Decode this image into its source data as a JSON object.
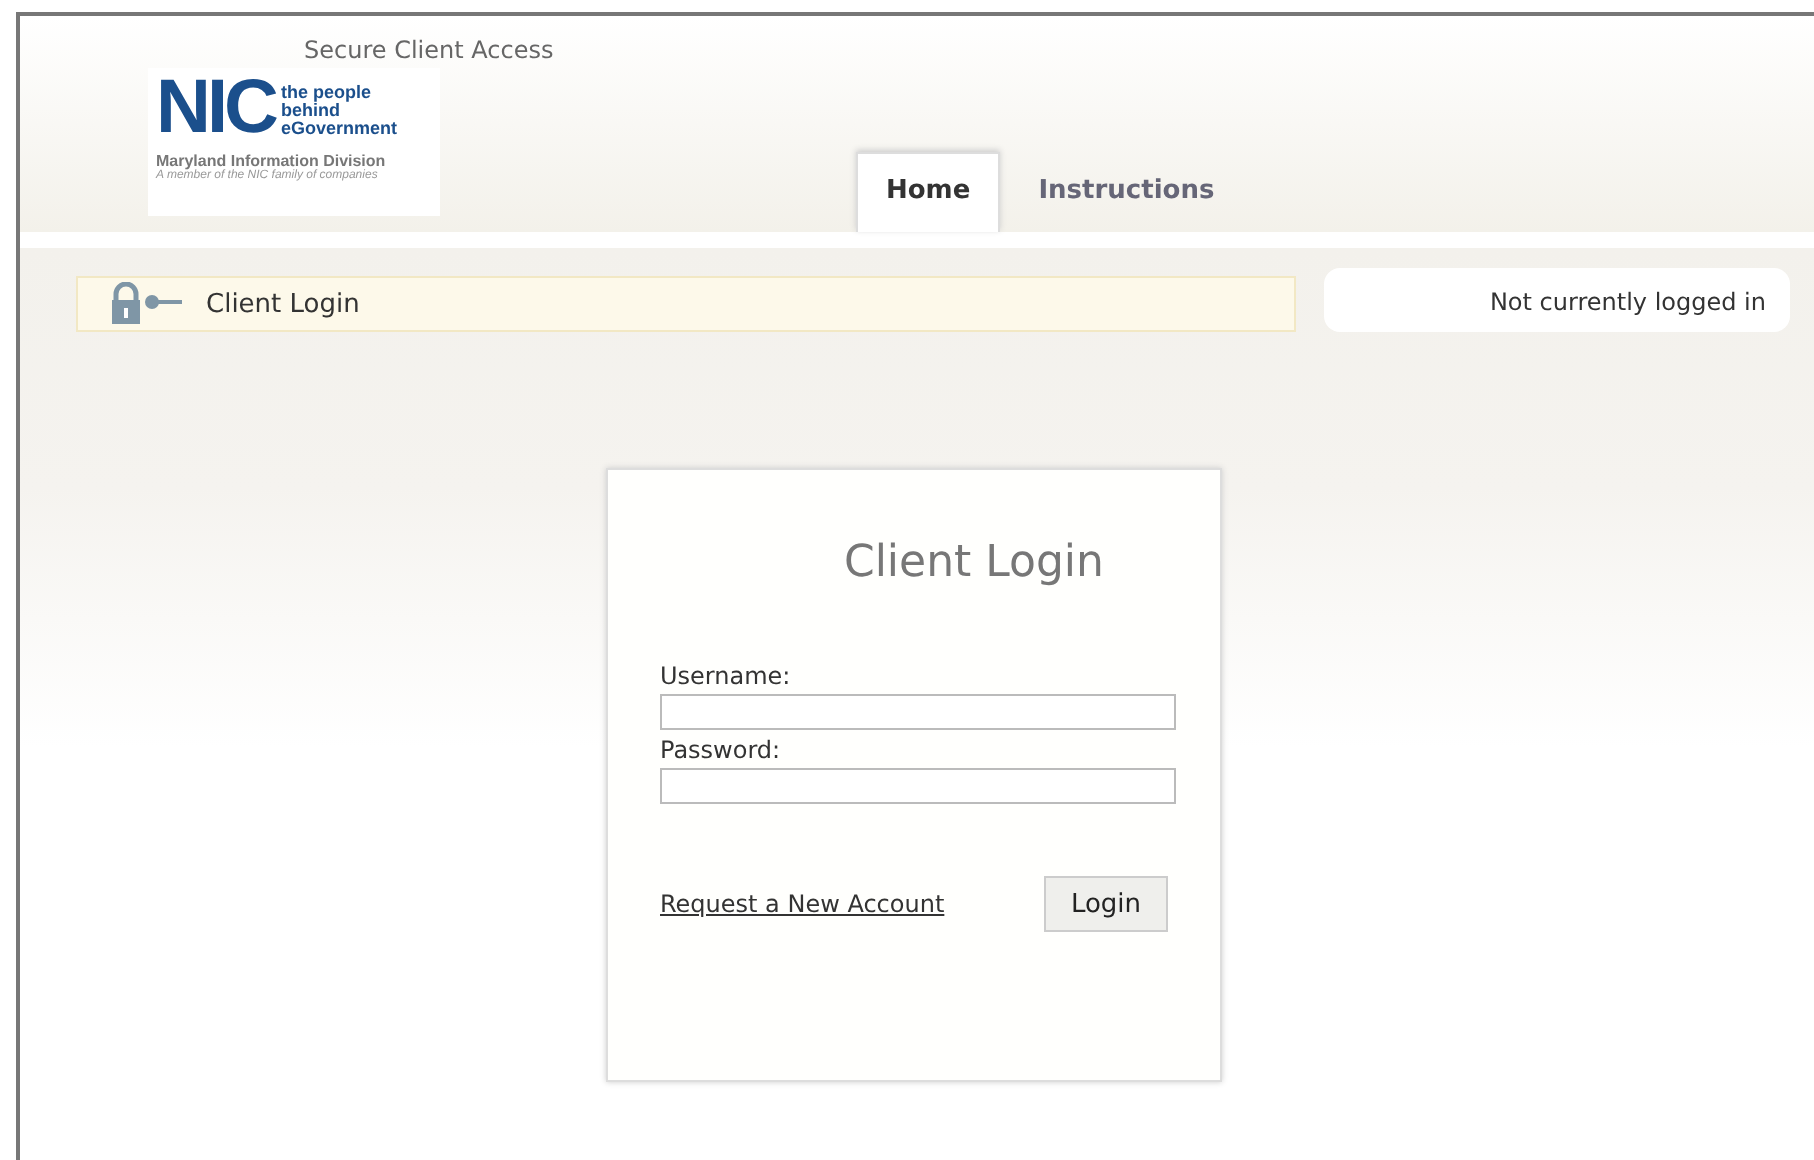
{
  "header": {
    "site_title": "Secure Client Access",
    "logo": {
      "mark": "NIC",
      "tagline": "the people behind eGovernment",
      "division": "Maryland Information Division",
      "member_note": "A member of the NIC family of companies"
    }
  },
  "tabs": [
    {
      "label": "Home",
      "selected": true
    },
    {
      "label": "Instructions",
      "selected": false
    }
  ],
  "breadcrumb": {
    "label": "Client Login"
  },
  "status": "Not currently logged in",
  "login_card": {
    "title": "Client Login",
    "fields": [
      {
        "label": "Username:"
      },
      {
        "label": "Password:"
      }
    ],
    "link": "Request a New Account",
    "button": "Login"
  }
}
